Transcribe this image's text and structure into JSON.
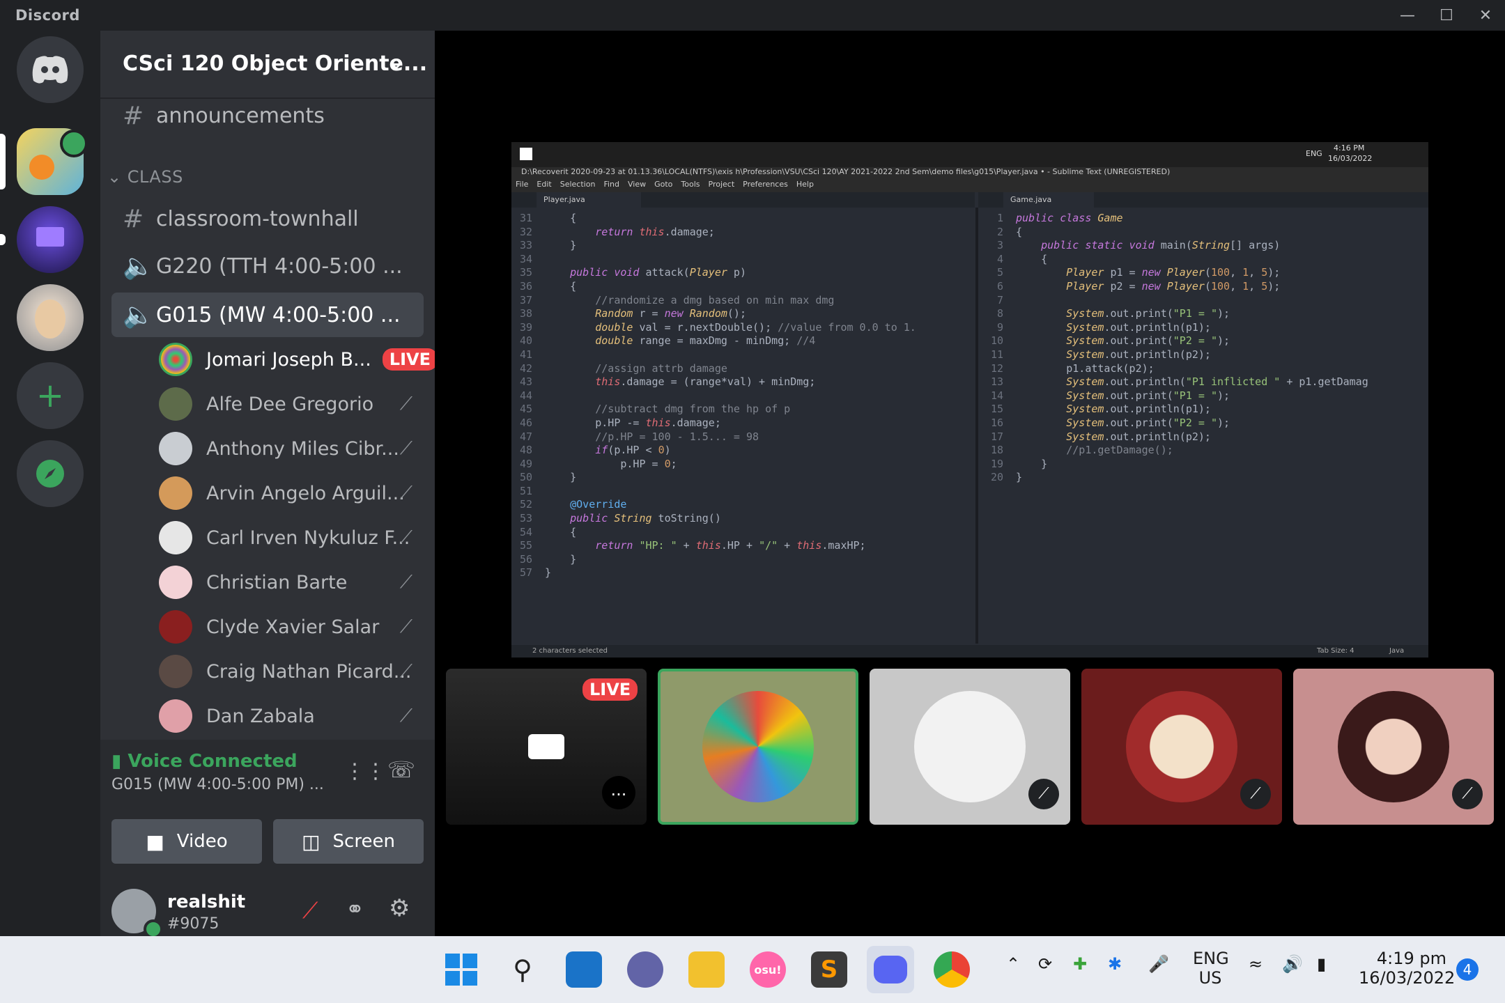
{
  "app": {
    "title": "Discord"
  },
  "guild": {
    "name": "CSci 120 Object Oriente..."
  },
  "channels": {
    "announcements": "announcements",
    "category": "CLASS",
    "townhall": "classroom-townhall",
    "g220": "G220 (TTH 4:00-5:00 ...",
    "g015": "G015 (MW 4:00-5:00 ..."
  },
  "voice_users": [
    {
      "name": "Jomari Joseph B...",
      "badge": "LIVE"
    },
    {
      "name": "Alfe Dee Gregorio"
    },
    {
      "name": "Anthony Miles Cibr..."
    },
    {
      "name": "Arvin Angelo Arguil..."
    },
    {
      "name": "Carl Irven Nykuluz F..."
    },
    {
      "name": "Christian Barte"
    },
    {
      "name": "Clyde Xavier Salar"
    },
    {
      "name": "Craig Nathan Picard..."
    },
    {
      "name": "Dan Zabala"
    }
  ],
  "voice_panel": {
    "status": "Voice Connected",
    "channel": "G015 (MW 4:00-5:00 PM) ...",
    "video_label": "Video",
    "screen_label": "Screen"
  },
  "account": {
    "username": "realshit",
    "tag": "#9075"
  },
  "stream": {
    "window_title": "D:\\Recoverit 2020-09-23 at 01.13.36\\LOCAL(NTFS)\\exis h\\Profession\\VSU\\CSci 120\\AY 2021-2022 2nd Sem\\demo files\\g015\\Player.java • - Sublime Text (UNREGISTERED)",
    "menu": [
      "File",
      "Edit",
      "Selection",
      "Find",
      "View",
      "Goto",
      "Tools",
      "Project",
      "Preferences",
      "Help"
    ],
    "tab_left": "Player.java",
    "tab_right": "Game.java",
    "status_left": "2 characters selected",
    "status_tab": "Tab Size: 4",
    "status_lang": "Java",
    "remote_time": "4:16 PM",
    "remote_date": "16/03/2022",
    "remote_lang": "ENG",
    "left_code": [
      {
        "n": "31",
        "t": "    {"
      },
      {
        "n": "32",
        "t": "        return this.damage;"
      },
      {
        "n": "33",
        "t": "    }"
      },
      {
        "n": "34",
        "t": ""
      },
      {
        "n": "35",
        "t": "    public void attack(Player p)"
      },
      {
        "n": "36",
        "t": "    {"
      },
      {
        "n": "37",
        "t": "        //randomize a dmg based on min max dmg"
      },
      {
        "n": "38",
        "t": "        Random r = new Random();"
      },
      {
        "n": "39",
        "t": "        double val = r.nextDouble(); //value from 0.0 to 1."
      },
      {
        "n": "40",
        "t": "        double range = maxDmg - minDmg; //4"
      },
      {
        "n": "41",
        "t": ""
      },
      {
        "n": "42",
        "t": "        //assign attrb damage"
      },
      {
        "n": "43",
        "t": "        this.damage = (range*val) + minDmg;"
      },
      {
        "n": "44",
        "t": ""
      },
      {
        "n": "45",
        "t": "        //subtract dmg from the hp of p"
      },
      {
        "n": "46",
        "t": "        p.HP -= this.damage;"
      },
      {
        "n": "47",
        "t": "        //p.HP = 100 - 1.5... = 98"
      },
      {
        "n": "48",
        "t": "        if(p.HP < 0)"
      },
      {
        "n": "49",
        "t": "            p.HP = 0;"
      },
      {
        "n": "50",
        "t": "    }"
      },
      {
        "n": "51",
        "t": ""
      },
      {
        "n": "52",
        "t": "    @Override"
      },
      {
        "n": "53",
        "t": "    public String toString()"
      },
      {
        "n": "54",
        "t": "    {"
      },
      {
        "n": "55",
        "t": "        return \"HP: \" + this.HP + \"/\" + this.maxHP;"
      },
      {
        "n": "56",
        "t": "    }"
      },
      {
        "n": "57",
        "t": "}"
      }
    ],
    "right_code": [
      {
        "n": "1",
        "t": "public class Game"
      },
      {
        "n": "2",
        "t": "{"
      },
      {
        "n": "3",
        "t": "    public static void main(String[] args)"
      },
      {
        "n": "4",
        "t": "    {"
      },
      {
        "n": "5",
        "t": "        Player p1 = new Player(100, 1, 5);"
      },
      {
        "n": "6",
        "t": "        Player p2 = new Player(100, 1, 5);"
      },
      {
        "n": "7",
        "t": ""
      },
      {
        "n": "8",
        "t": "        System.out.print(\"P1 = \");"
      },
      {
        "n": "9",
        "t": "        System.out.println(p1);"
      },
      {
        "n": "10",
        "t": "        System.out.print(\"P2 = \");"
      },
      {
        "n": "11",
        "t": "        System.out.println(p2);"
      },
      {
        "n": "12",
        "t": "        p1.attack(p2);"
      },
      {
        "n": "13",
        "t": "        System.out.println(\"P1 inflicted \" + p1.getDamag"
      },
      {
        "n": "14",
        "t": "        System.out.print(\"P1 = \");"
      },
      {
        "n": "15",
        "t": "        System.out.println(p1);"
      },
      {
        "n": "16",
        "t": "        System.out.print(\"P2 = \");"
      },
      {
        "n": "17",
        "t": "        System.out.println(p2);"
      },
      {
        "n": "18",
        "t": "        //p1.getDamage();"
      },
      {
        "n": "19",
        "t": "    }"
      },
      {
        "n": "20",
        "t": "}"
      }
    ]
  },
  "tiles": {
    "live_badge": "LIVE",
    "more": "..."
  },
  "taskbar": {
    "lang_top": "ENG",
    "lang_bottom": "US",
    "time": "4:19 pm",
    "date": "16/03/2022",
    "notif_count": "4",
    "osu_label": "osu!"
  }
}
